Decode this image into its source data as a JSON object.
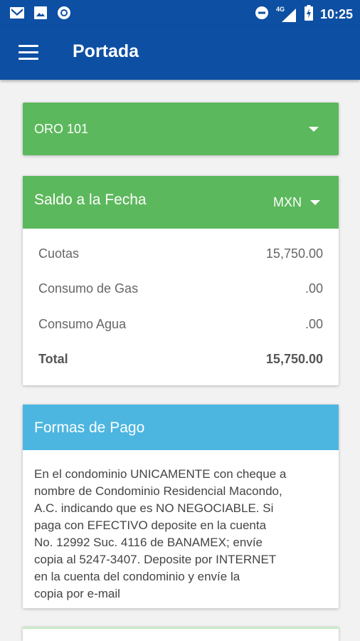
{
  "status_bar": {
    "time": "10:25",
    "network": "4G",
    "icons": [
      "gmail-icon",
      "gallery-icon",
      "circle-app-icon",
      "do-not-disturb-icon",
      "signal-icon",
      "battery-icon"
    ]
  },
  "app_bar": {
    "title": "Portada",
    "menu_icon": "hamburger-menu-icon"
  },
  "unit_selector": {
    "value": "ORO 101"
  },
  "saldo": {
    "title": "Saldo a la Fecha",
    "currency": "MXN",
    "rows": [
      {
        "label": "Cuotas",
        "value": "15,750.00"
      },
      {
        "label": "Consumo de Gas",
        "value": ".00"
      },
      {
        "label": "Consumo Agua",
        "value": ".00"
      }
    ],
    "total": {
      "label": "Total",
      "value": "15,750.00"
    }
  },
  "formas_pago": {
    "title": "Formas de Pago",
    "lines": [
      "En el condominio UNICAMENTE con cheque a",
      "nombre de Condominio Residencial Macondo,",
      "A.C. indicando que es NO NEGOCIABLE. Si",
      "paga con EFECTIVO deposite en la cuenta",
      "No. 12992 Suc. 4116 de BANAMEX; envíe",
      "copia al 5247-3407. Deposite por INTERNET",
      "en la cuenta del condominio y envíe la",
      "copia por e-mail"
    ]
  },
  "colors": {
    "app_bar": "#0d4fa3",
    "green_header": "#5cb85c",
    "blue_header": "#4cb6e0",
    "background": "#f2f2f2"
  }
}
